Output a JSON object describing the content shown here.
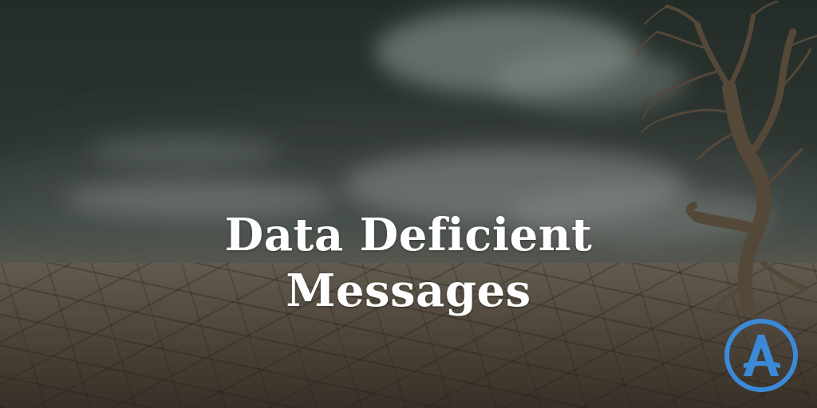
{
  "title": {
    "line1": "Data Deficient",
    "line2": "Messages"
  },
  "logo": {
    "icon": "brand-a-circle-logo",
    "color": "#3b8ad8"
  }
}
